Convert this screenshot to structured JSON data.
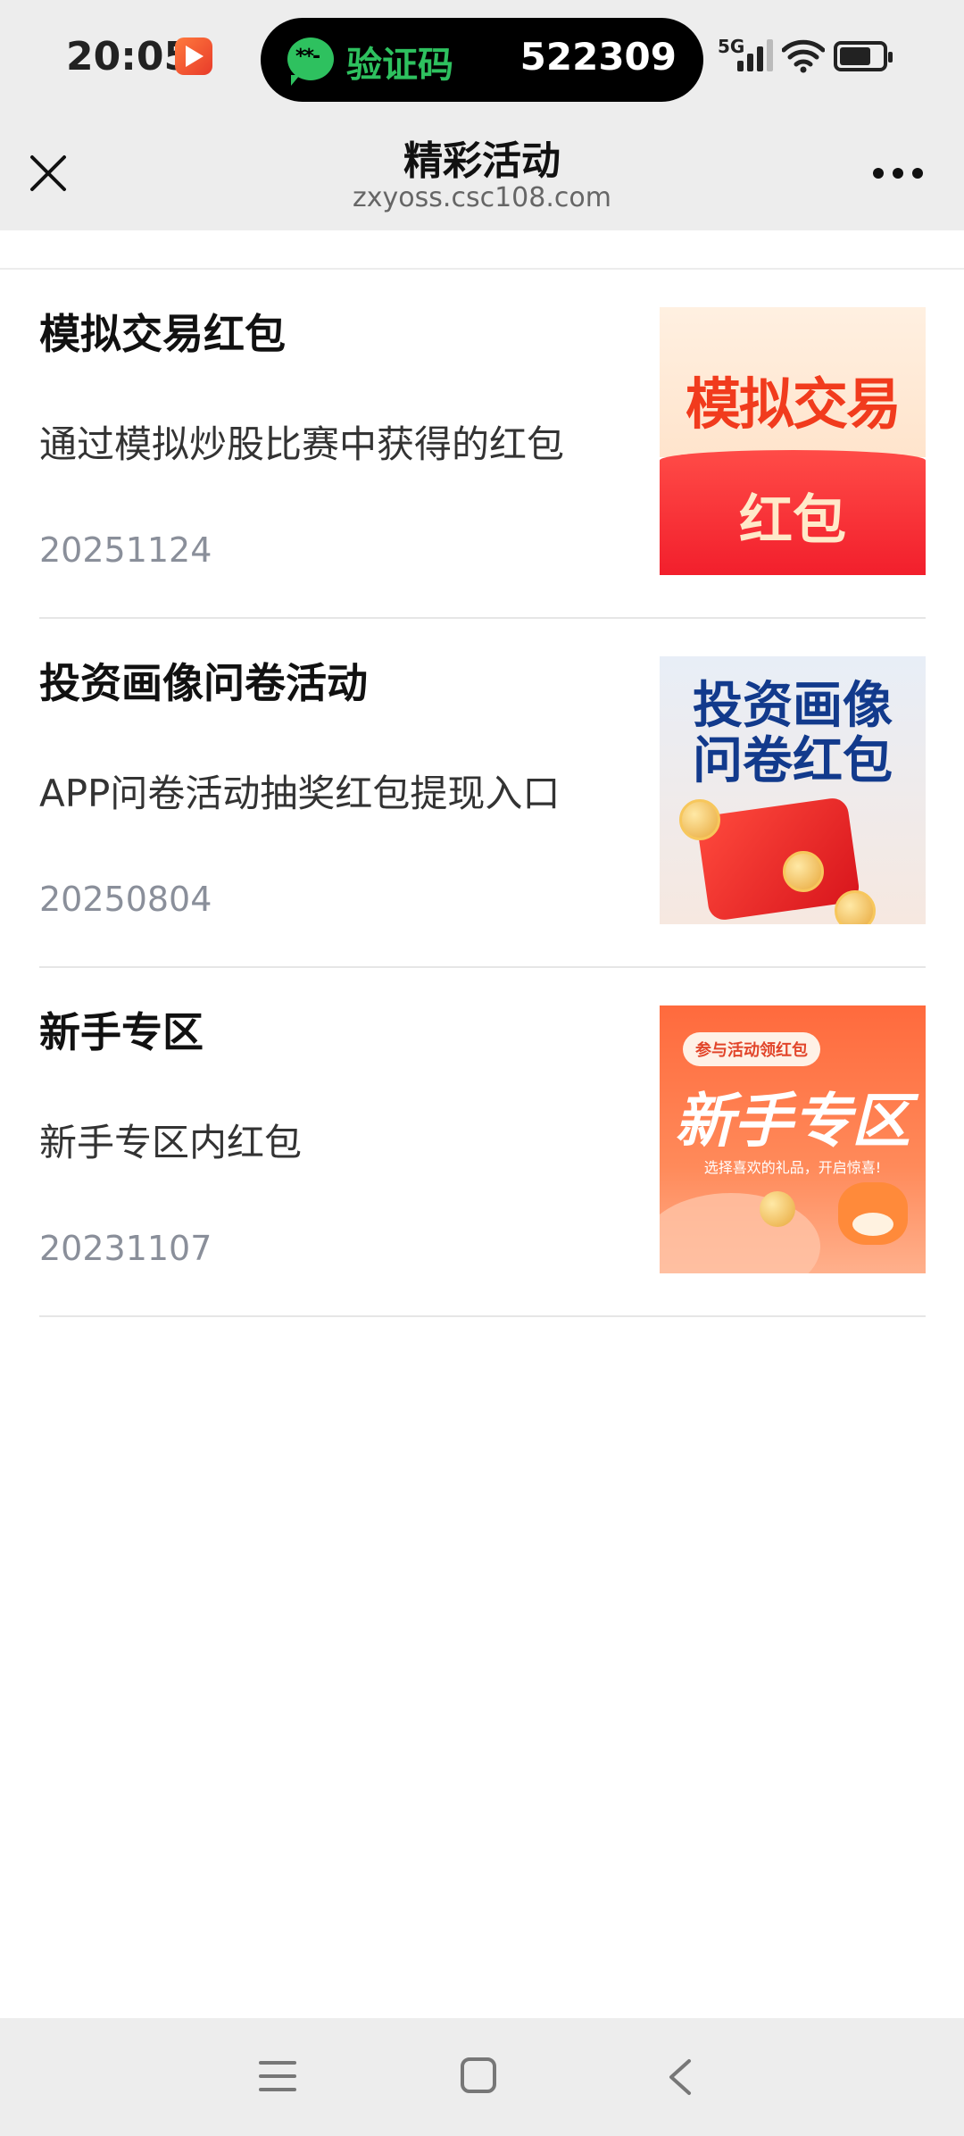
{
  "status_bar": {
    "time": "20:05",
    "notification_label": "验证码",
    "notification_code": "522309",
    "network": "5G"
  },
  "nav": {
    "title": "精彩活动",
    "url": "zxyoss.csc108.com"
  },
  "items": [
    {
      "title": "模拟交易红包",
      "desc": "通过模拟炒股比赛中获得的红包",
      "date": "20251124",
      "thumb_line1": "模拟交易",
      "thumb_line2": "红包"
    },
    {
      "title": "投资画像问卷活动",
      "desc": "APP问卷活动抽奖红包提现入口",
      "date": "20250804",
      "thumb_line1": "投资画像",
      "thumb_line2": "问卷红包"
    },
    {
      "title": "新手专区",
      "desc": "新手专区内红包",
      "date": "20231107",
      "thumb_tag": "参与活动领红包",
      "thumb_title": "新手专区",
      "thumb_sub": "选择喜欢的礼品，开启惊喜!"
    }
  ],
  "icons": {
    "close": "close-icon",
    "more": "more-icon",
    "menu": "menu-icon",
    "home": "home-icon",
    "back": "back-icon"
  },
  "colors": {
    "bar_bg": "#ededed",
    "wechat_green": "#2ec15f",
    "date_gray": "#8a8f9a"
  }
}
